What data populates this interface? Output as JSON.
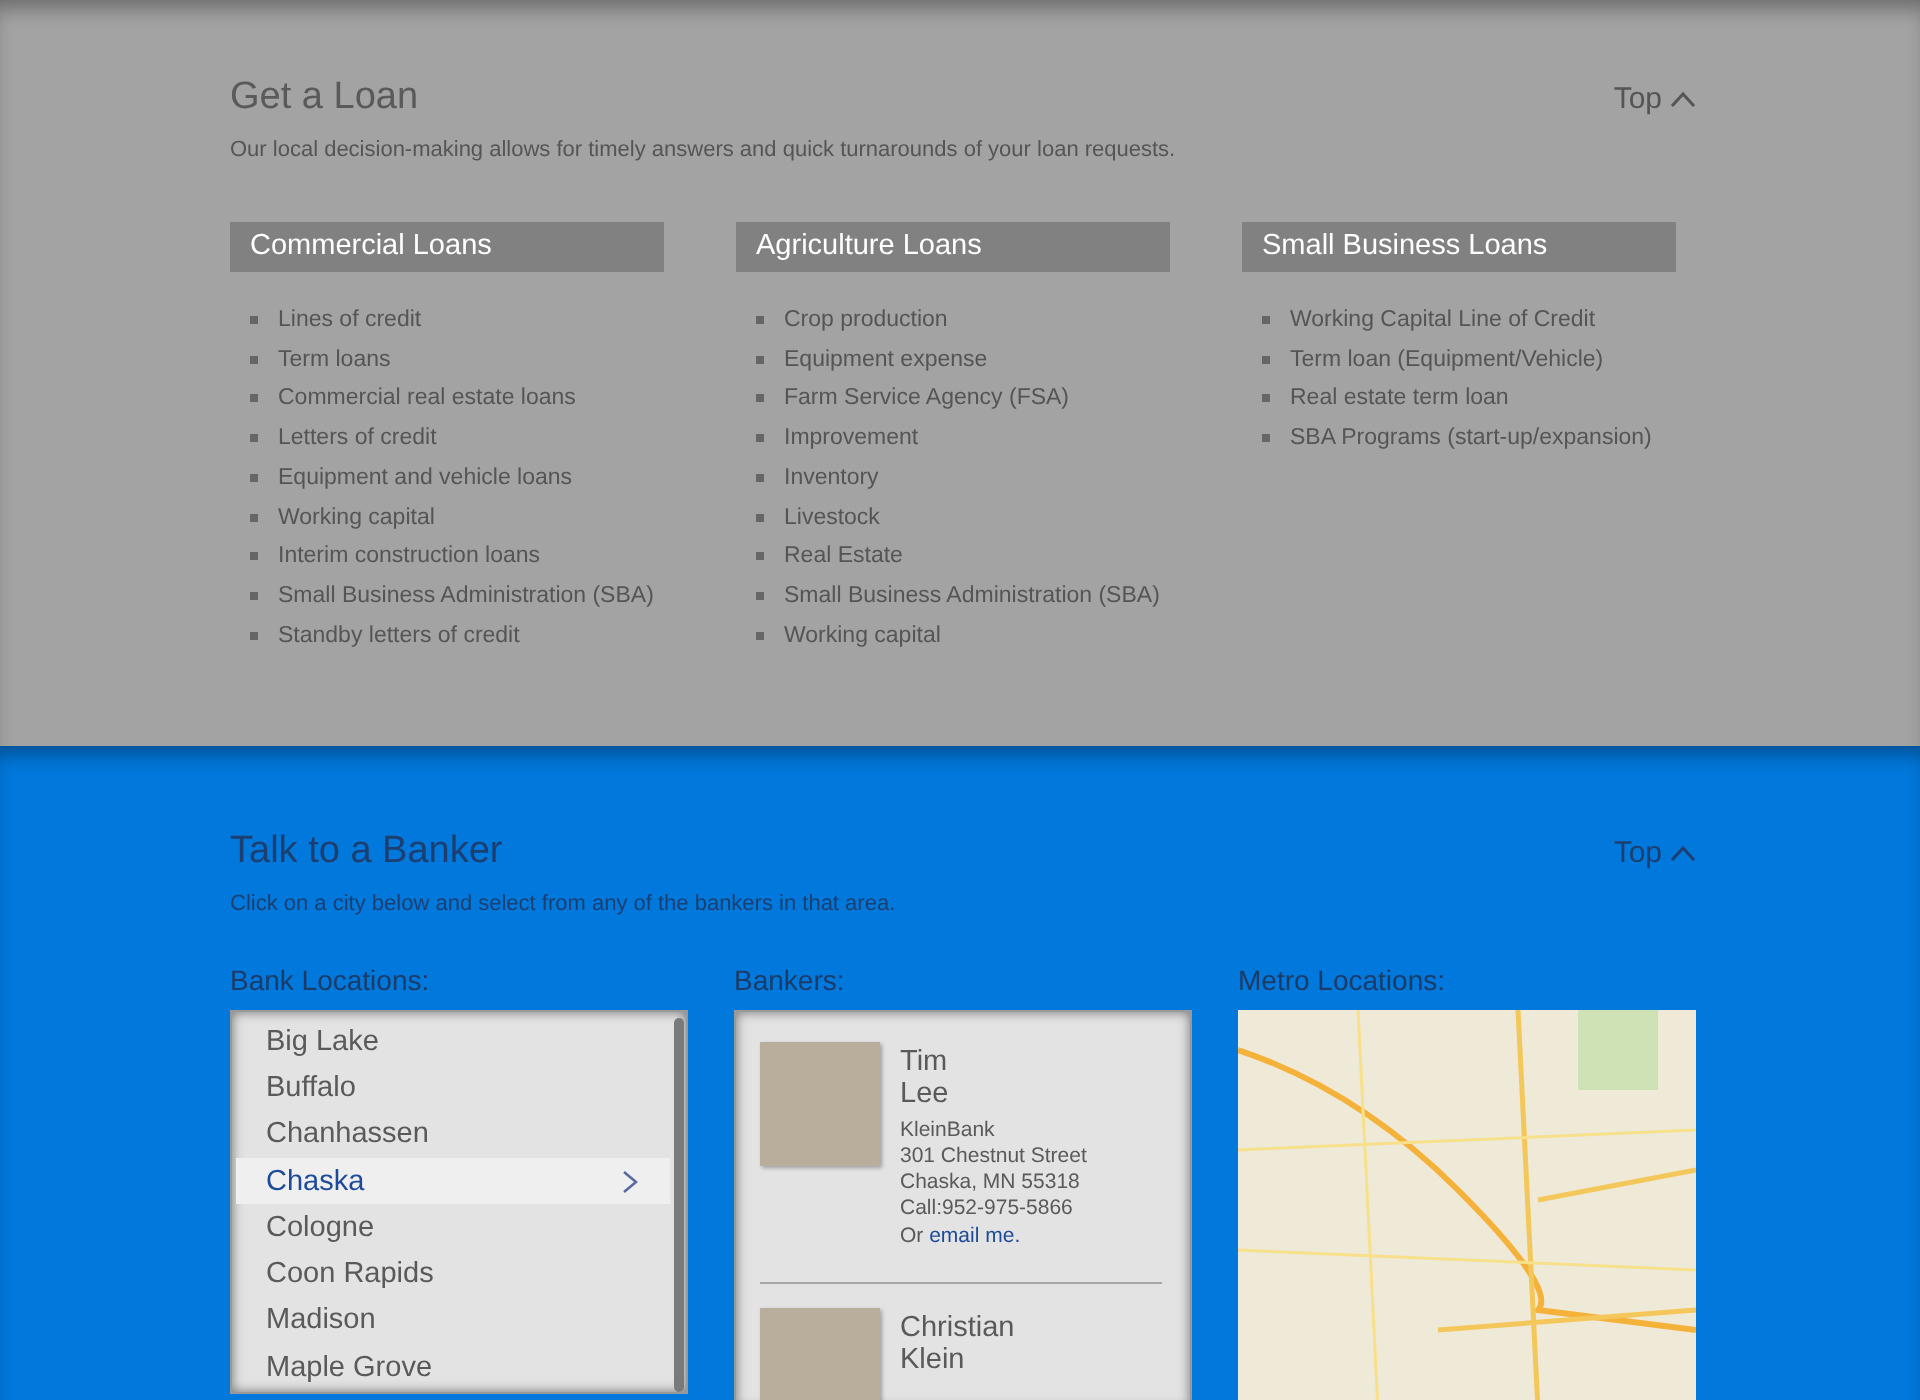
{
  "loans": {
    "title": "Get a Loan",
    "top_link": "Top",
    "description": "Our local decision-making allows for timely answers and quick turnarounds of your loan requests.",
    "columns": [
      {
        "heading": "Commercial Loans",
        "items": [
          "Lines of credit",
          "Term loans",
          "Commercial real estate loans",
          "Letters of credit",
          "Equipment and vehicle loans",
          "Working capital",
          "Interim construction loans",
          "Small Business Administration (SBA)",
          "Standby letters of credit"
        ]
      },
      {
        "heading": "Agriculture Loans",
        "items": [
          "Crop production",
          "Equipment expense",
          "Farm Service Agency (FSA)",
          "Improvement",
          "Inventory",
          "Livestock",
          "Real Estate",
          "Small Business Administration (SBA)",
          "Working capital"
        ]
      },
      {
        "heading": "Small Business Loans",
        "items": [
          "Working Capital Line of Credit",
          "Term loan (Equipment/Vehicle)",
          "Real estate term loan",
          "SBA Programs (start-up/expansion)"
        ]
      }
    ]
  },
  "banker": {
    "title": "Talk to a Banker",
    "top_link": "Top",
    "description": "Click on a city below and select from any of the bankers in that area.",
    "locations": {
      "label": "Bank Locations:",
      "items": [
        {
          "name": "Big Lake",
          "selected": false
        },
        {
          "name": "Buffalo",
          "selected": false
        },
        {
          "name": "Chanhassen",
          "selected": false
        },
        {
          "name": "Chaska",
          "selected": true
        },
        {
          "name": "Cologne",
          "selected": false
        },
        {
          "name": "Coon Rapids",
          "selected": false
        },
        {
          "name": "Madison",
          "selected": false
        },
        {
          "name": "Maple Grove",
          "selected": false
        }
      ]
    },
    "bankers": {
      "label": "Bankers:",
      "items": [
        {
          "first_name": "Tim",
          "last_name": "Lee",
          "details": [
            "KleinBank",
            "301 Chestnut Street",
            "Chaska, MN 55318",
            "Call:952-975-5866"
          ],
          "email_prefix": "Or ",
          "email_link": "email me."
        },
        {
          "first_name": "Christian",
          "last_name": "Klein"
        }
      ]
    },
    "metro": {
      "label": "Metro Locations:"
    }
  }
}
